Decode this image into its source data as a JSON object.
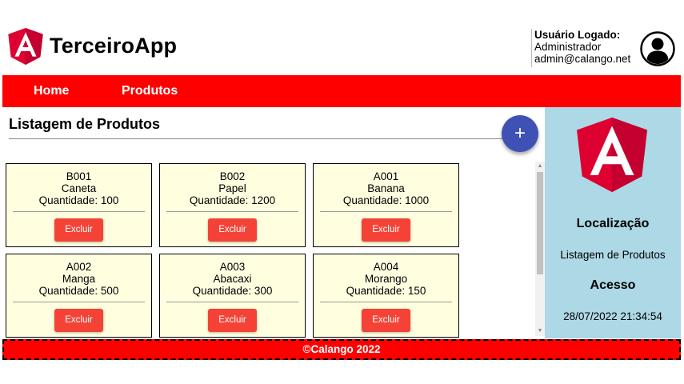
{
  "header": {
    "app_title": "TerceiroApp",
    "user_label": "Usuário Logado:",
    "user_name": "Administrador",
    "user_email": "admin@calango.net"
  },
  "nav": {
    "items": [
      {
        "label": "Home"
      },
      {
        "label": "Produtos"
      }
    ]
  },
  "main": {
    "title": "Listagem de Produtos",
    "add_button_label": "+",
    "quantity_prefix": "Quantidade: ",
    "delete_label": "Excluir",
    "products": [
      {
        "code": "B001",
        "name": "Caneta",
        "quantity": "Quantidade: 100"
      },
      {
        "code": "B002",
        "name": "Papel",
        "quantity": "Quantidade: 1200"
      },
      {
        "code": "A001",
        "name": "Banana",
        "quantity": "Quantidade: 1000"
      },
      {
        "code": "A002",
        "name": "Manga",
        "quantity": "Quantidade: 500"
      },
      {
        "code": "A003",
        "name": "Abacaxi",
        "quantity": "Quantidade: 300"
      },
      {
        "code": "A004",
        "name": "Morango",
        "quantity": "Quantidade: 150"
      }
    ]
  },
  "sidebar": {
    "location_heading": "Localização",
    "location_value": "Listagem de Produtos",
    "access_heading": "Acesso",
    "access_value": "28/07/2022 21:34:54"
  },
  "footer": {
    "text": "©Calango 2022"
  },
  "colors": {
    "navbar": "#ff0000",
    "card_bg": "#ffffe0",
    "delete_button": "#f44336",
    "fab": "#3f51b5",
    "sidebar_bg": "#add8e6",
    "angular_red": "#dd0031"
  },
  "icons": {
    "app_logo": "angular-logo-icon",
    "avatar": "user-avatar-icon",
    "sidebar_logo": "angular-logo-icon"
  }
}
